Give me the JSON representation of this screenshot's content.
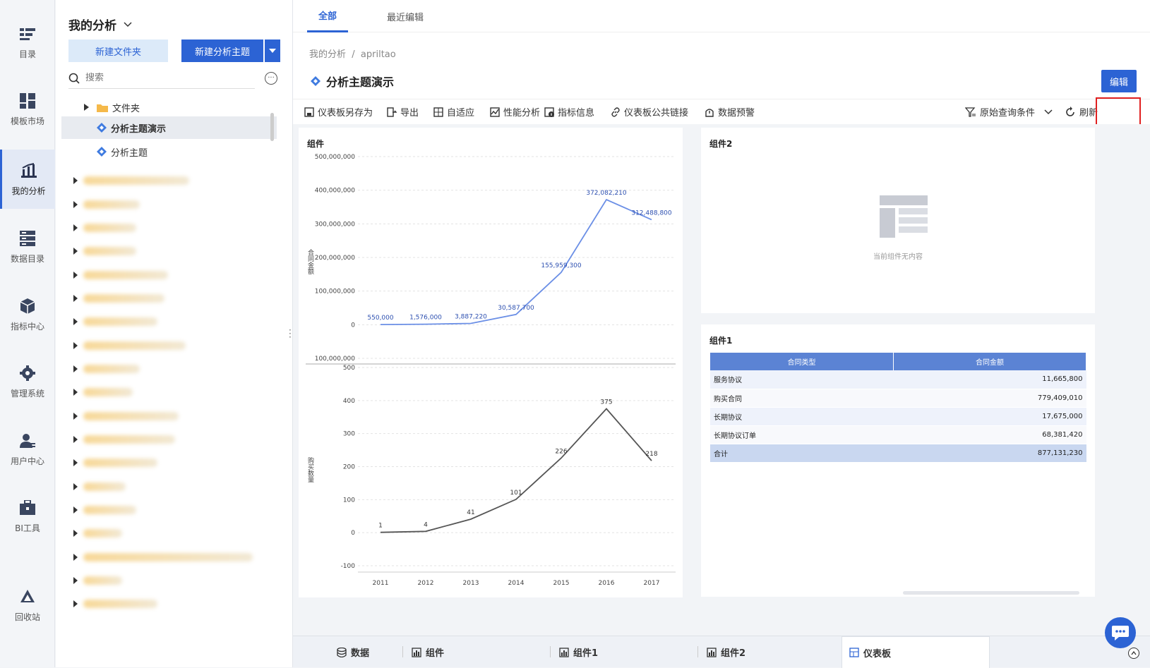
{
  "nav": [
    {
      "label": "目录",
      "icon": "list-icon"
    },
    {
      "label": "模板市场",
      "icon": "grid-icon"
    },
    {
      "label": "我的分析",
      "icon": "analysis-icon",
      "active": true
    },
    {
      "label": "数据目录",
      "icon": "database-icon"
    },
    {
      "label": "指标中心",
      "icon": "cube-icon"
    },
    {
      "label": "管理系统",
      "icon": "gear-icon"
    },
    {
      "label": "用户中心",
      "icon": "user-icon"
    },
    {
      "label": "BI工具",
      "icon": "toolbox-icon"
    },
    {
      "label": "回收站",
      "icon": "recycle-icon"
    }
  ],
  "tree": {
    "title": "我的分析",
    "new_folder": "新建文件夹",
    "new_subject": "新建分析主题",
    "search_placeholder": "搜索",
    "items": [
      {
        "label": "文件夹",
        "type": "folder"
      },
      {
        "label": "分析主题演示",
        "type": "subject",
        "selected": true
      },
      {
        "label": "分析主题",
        "type": "subject"
      }
    ]
  },
  "tabs": [
    {
      "label": "全部",
      "active": true
    },
    {
      "label": "最近编辑"
    }
  ],
  "breadcrumb": "我的分析  /  apriltao",
  "page_title": "分析主题演示",
  "edit_label": "编辑",
  "toolbar": {
    "save_as": "仪表板另存为",
    "export": "导出",
    "adaptive": "自适应",
    "performance": "性能分析",
    "metric_info": "指标信息",
    "public_link": "仪表板公共链接",
    "alert": "数据预警",
    "query_conditions": "原始查询条件",
    "refresh": "刷新"
  },
  "panels": {
    "chart_title": "组件",
    "empty_title": "组件2",
    "empty_text": "当前组件无内容",
    "table_title": "组件1"
  },
  "chart_data": [
    {
      "type": "line",
      "x": [
        "2011",
        "2012",
        "2013",
        "2014",
        "2015",
        "2016",
        "2017"
      ],
      "series": [
        {
          "values": [
            550000,
            1576000,
            3887220,
            30587700,
            155959300,
            372082210,
            312488800
          ]
        }
      ],
      "ylabel": "合同金额",
      "yticks": [
        "500,000,000",
        "400,000,000",
        "300,000,000",
        "200,000,000",
        "100,000,000",
        "0",
        "100,000,000"
      ],
      "ylim": [
        -100000000,
        500000000
      ],
      "labels": [
        "550,000",
        "1,576,000",
        "3,887,220",
        "30,587,700",
        "155,959,300",
        "372,082,210",
        "312,488,800"
      ],
      "color": "#6b8fe6"
    },
    {
      "type": "line",
      "x": [
        "2011",
        "2012",
        "2013",
        "2014",
        "2015",
        "2016",
        "2017"
      ],
      "series": [
        {
          "values": [
            1,
            4,
            41,
            101,
            226,
            375,
            218
          ]
        }
      ],
      "ylabel": "购买数量",
      "yticks": [
        "500",
        "400",
        "300",
        "200",
        "100",
        "0",
        "-100"
      ],
      "ylim": [
        -100,
        500
      ],
      "labels": [
        "1",
        "4",
        "41",
        "101",
        "226",
        "375",
        "218"
      ],
      "color": "#555555"
    },
    {
      "type": "table",
      "columns": [
        "合同类型",
        "合同金额"
      ],
      "rows": [
        [
          "服务协议",
          "11,665,800"
        ],
        [
          "购买合同",
          "779,409,010"
        ],
        [
          "长期协议",
          "17,675,000"
        ],
        [
          "长期协议订单",
          "68,381,420"
        ]
      ],
      "total": [
        "合计",
        "877,131,230"
      ]
    }
  ],
  "bottom_tabs": [
    {
      "label": "数据",
      "icon": "database-icon"
    },
    {
      "label": "组件",
      "icon": "chart-icon"
    },
    {
      "label": "组件1",
      "icon": "chart-icon"
    },
    {
      "label": "组件2",
      "icon": "chart-icon"
    },
    {
      "label": "仪表板",
      "icon": "dashboard-icon",
      "active": true
    }
  ],
  "colors": {
    "accent": "#2c63d4",
    "highlight": "#e02020"
  }
}
